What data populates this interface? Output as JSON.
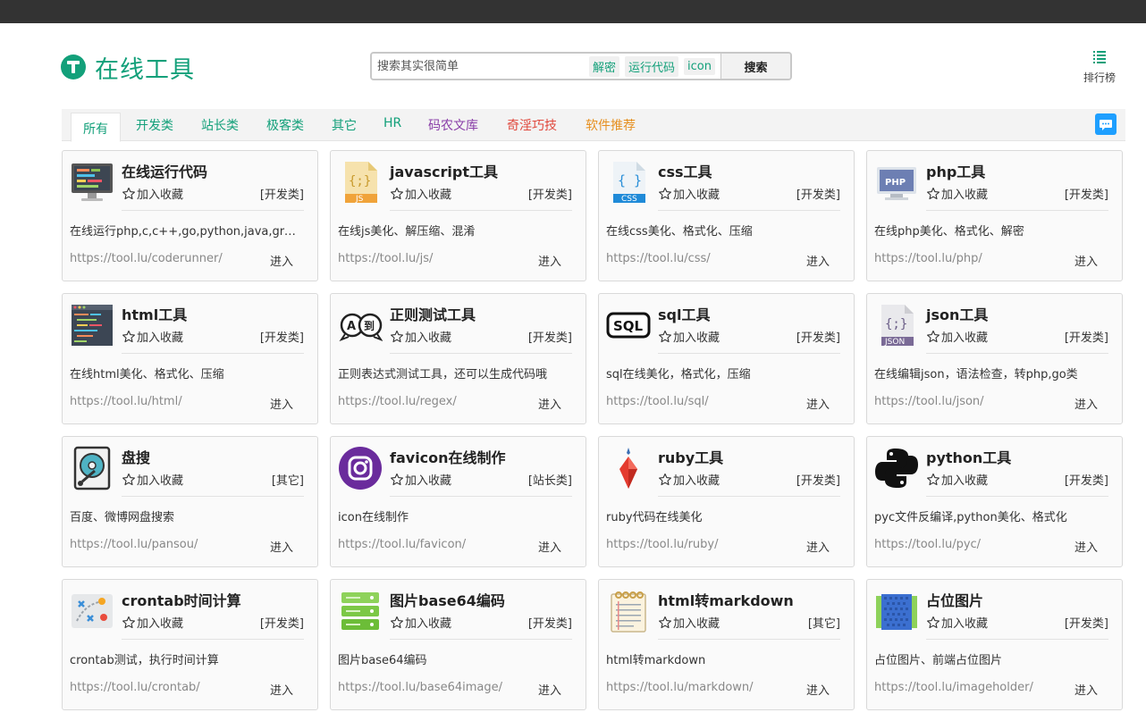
{
  "header": {
    "logo_text": "在线工具",
    "search_placeholder": "搜索其实很简单",
    "quick_links": [
      "解密",
      "运行代码",
      "icon"
    ],
    "search_button": "搜索",
    "rank_label": "排行榜"
  },
  "tabs": [
    {
      "label": "所有",
      "color": "#13a07a"
    },
    {
      "label": "开发类",
      "color": "#13a07a"
    },
    {
      "label": "站长类",
      "color": "#13a07a"
    },
    {
      "label": "极客类",
      "color": "#13a07a"
    },
    {
      "label": "其它",
      "color": "#13a07a"
    },
    {
      "label": "HR",
      "color": "#13a07a"
    },
    {
      "label": "码农文库",
      "color": "#8a3fa8"
    },
    {
      "label": "奇淫巧技",
      "color": "#e0483d"
    },
    {
      "label": "软件推荐",
      "color": "#e68f1f"
    }
  ],
  "fav_label": "加入收藏",
  "enter_label": "进入",
  "cards": [
    {
      "title": "在线运行代码",
      "icon": "monitor-code-icon",
      "category": "[开发类]",
      "desc": "在线运行php,c,c++,go,python,java,groovy,rust,ruby等代码",
      "url": "https://tool.lu/coderunner/"
    },
    {
      "title": "javascript工具",
      "icon": "js-file-icon",
      "category": "[开发类]",
      "desc": "在线js美化、解压缩、混淆",
      "url": "https://tool.lu/js/"
    },
    {
      "title": "css工具",
      "icon": "css-file-icon",
      "category": "[开发类]",
      "desc": "在线css美化、格式化、压缩",
      "url": "https://tool.lu/css/"
    },
    {
      "title": "php工具",
      "icon": "php-icon",
      "category": "[开发类]",
      "desc": "在线php美化、格式化、解密",
      "url": "https://tool.lu/php/"
    },
    {
      "title": "html工具",
      "icon": "html-editor-icon",
      "category": "[开发类]",
      "desc": "在线html美化、格式化、压缩",
      "url": "https://tool.lu/html/"
    },
    {
      "title": "正则测试工具",
      "icon": "regex-bubble-icon",
      "category": "[开发类]",
      "desc": "正则表达式测试工具，还可以生成代码哦",
      "url": "https://tool.lu/regex/"
    },
    {
      "title": "sql工具",
      "icon": "sql-icon",
      "category": "[开发类]",
      "desc": "sql在线美化，格式化，压缩",
      "url": "https://tool.lu/sql/"
    },
    {
      "title": "json工具",
      "icon": "json-file-icon",
      "category": "[开发类]",
      "desc": "在线编辑json，语法检查，转php,go类",
      "url": "https://tool.lu/json/"
    },
    {
      "title": "盘搜",
      "icon": "hard-disk-icon",
      "category": "[其它]",
      "desc": "百度、微博网盘搜索",
      "url": "https://tool.lu/pansou/"
    },
    {
      "title": "favicon在线制作",
      "icon": "instagram-icon",
      "category": "[站长类]",
      "desc": "icon在线制作",
      "url": "https://tool.lu/favicon/"
    },
    {
      "title": "ruby工具",
      "icon": "ruby-gem-icon",
      "category": "[开发类]",
      "desc": "ruby代码在线美化",
      "url": "https://tool.lu/ruby/"
    },
    {
      "title": "python工具",
      "icon": "python-icon",
      "category": "[开发类]",
      "desc": "pyc文件反编译,python美化、格式化",
      "url": "https://tool.lu/pyc/"
    },
    {
      "title": "crontab时间计算",
      "icon": "strategy-board-icon",
      "category": "[开发类]",
      "desc": "crontab测试，执行时间计算",
      "url": "https://tool.lu/crontab/"
    },
    {
      "title": "图片base64编码",
      "icon": "database-icon",
      "category": "[开发类]",
      "desc": "图片base64编码",
      "url": "https://tool.lu/base64image/"
    },
    {
      "title": "html转markdown",
      "icon": "notepad-icon",
      "category": "[其它]",
      "desc": "html转markdown",
      "url": "https://tool.lu/markdown/"
    },
    {
      "title": "占位图片",
      "icon": "placeholder-image-icon",
      "category": "[开发类]",
      "desc": "占位图片、前端占位图片",
      "url": "https://tool.lu/imageholder/"
    }
  ]
}
